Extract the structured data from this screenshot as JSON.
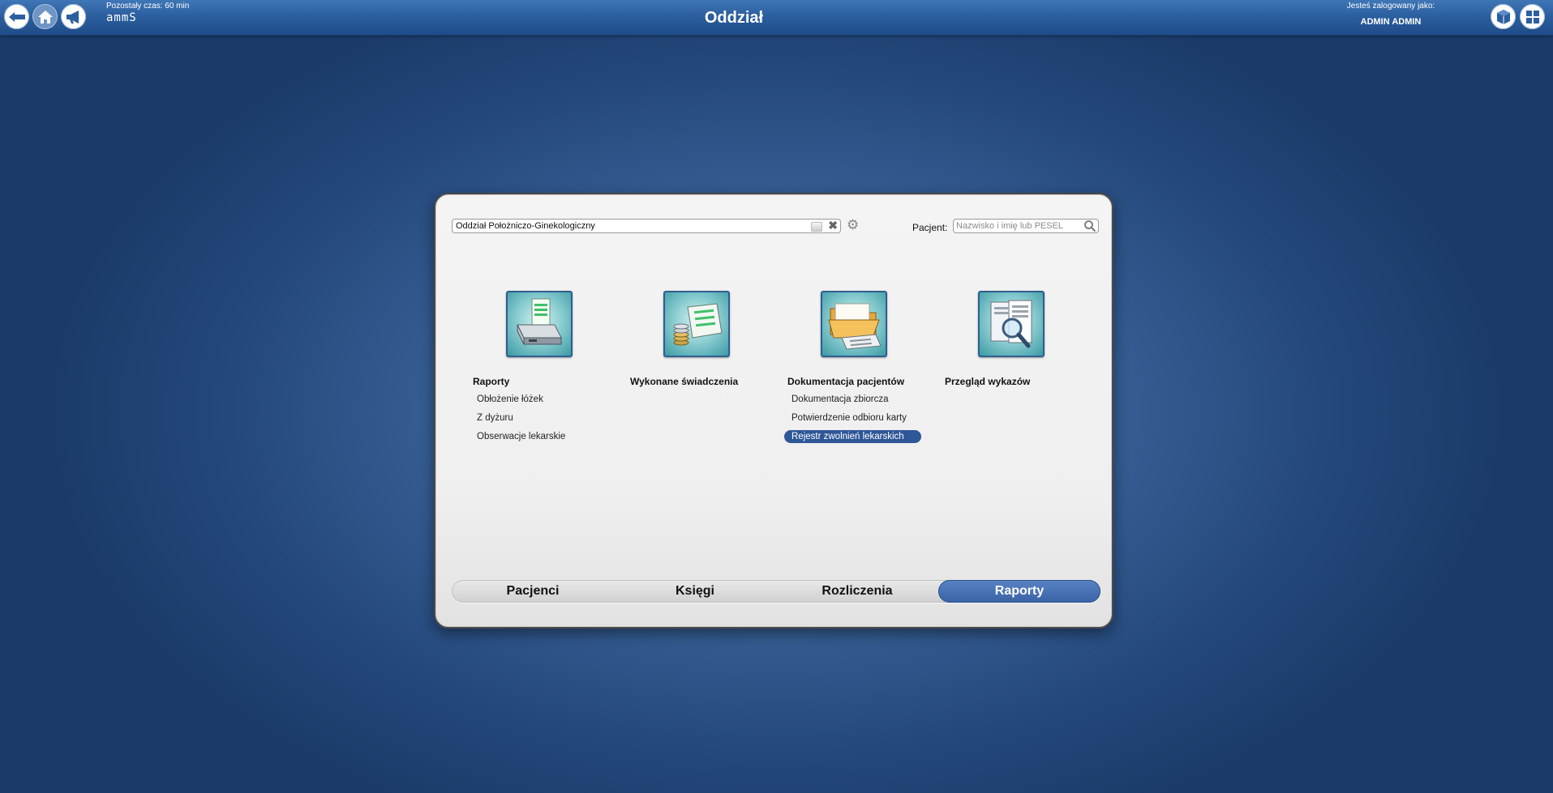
{
  "header": {
    "title": "Oddział",
    "timer": "Pozostały czas: 60 min",
    "logo": "ammS",
    "login_label": "Jesteś zalogowany jako:",
    "login_user": "ADMIN ADMIN",
    "icons": [
      "back-icon",
      "home-icon",
      "megaphone-icon",
      "cube-icon",
      "grid-icon"
    ]
  },
  "filters": {
    "ward": "Oddział Położniczo-Ginekologiczny",
    "patient_label": "Pacjent:",
    "patient_placeholder": "Nazwisko i imię lub PESEL"
  },
  "modules": [
    {
      "title": "Raporty",
      "icon": "printer-icon",
      "items": [
        "Obłożenie łóżek",
        "Z dyżuru",
        "Obserwacje lekarskie"
      ]
    },
    {
      "title": "Wykonane świadczenia",
      "icon": "register-coins-icon",
      "items": []
    },
    {
      "title": "Dokumentacja pacjentów",
      "icon": "folder-icon",
      "items": [
        "Dokumentacja zbiorcza",
        "Potwierdzenie odbioru karty",
        "Rejestr zwolnień lekarskich"
      ],
      "active_item": "Rejestr zwolnień lekarskich"
    },
    {
      "title": "Przegląd wykazów",
      "icon": "document-magnifier-icon",
      "items": []
    }
  ],
  "tabs": [
    {
      "label": "Pacjenci"
    },
    {
      "label": "Księgi"
    },
    {
      "label": "Rozliczenia"
    },
    {
      "label": "Raporty"
    }
  ],
  "active_tab": "Raporty",
  "colors": {
    "accent": "#2e5797",
    "header": "#2c5f9f",
    "background": "#2b5189"
  }
}
